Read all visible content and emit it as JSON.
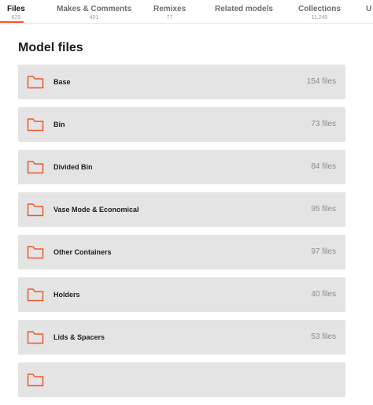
{
  "tabs": [
    {
      "label": "Files",
      "count": "625",
      "active": true
    },
    {
      "label": "Makes & Comments",
      "count": "401"
    },
    {
      "label": "Remixes",
      "count": "77"
    },
    {
      "label": "Related models",
      "count": ""
    },
    {
      "label": "Collections",
      "count": "11,240"
    },
    {
      "label": "U",
      "count": ""
    }
  ],
  "section": {
    "title": "Model files"
  },
  "folders": [
    {
      "name": "Base",
      "count": "154 files"
    },
    {
      "name": "Bin",
      "count": "73 files"
    },
    {
      "name": "Divided Bin",
      "count": "84 files"
    },
    {
      "name": "Vase Mode & Economical",
      "count": "95 files"
    },
    {
      "name": "Other Containers",
      "count": "97 files"
    },
    {
      "name": "Holders",
      "count": "40 files"
    },
    {
      "name": "Lids & Spacers",
      "count": "53 files"
    },
    {
      "name": "",
      "count": ""
    }
  ],
  "colors": {
    "accent": "#f0562d",
    "row_bg": "#e4e4e4"
  },
  "icons": {
    "folder": "folder-icon"
  }
}
